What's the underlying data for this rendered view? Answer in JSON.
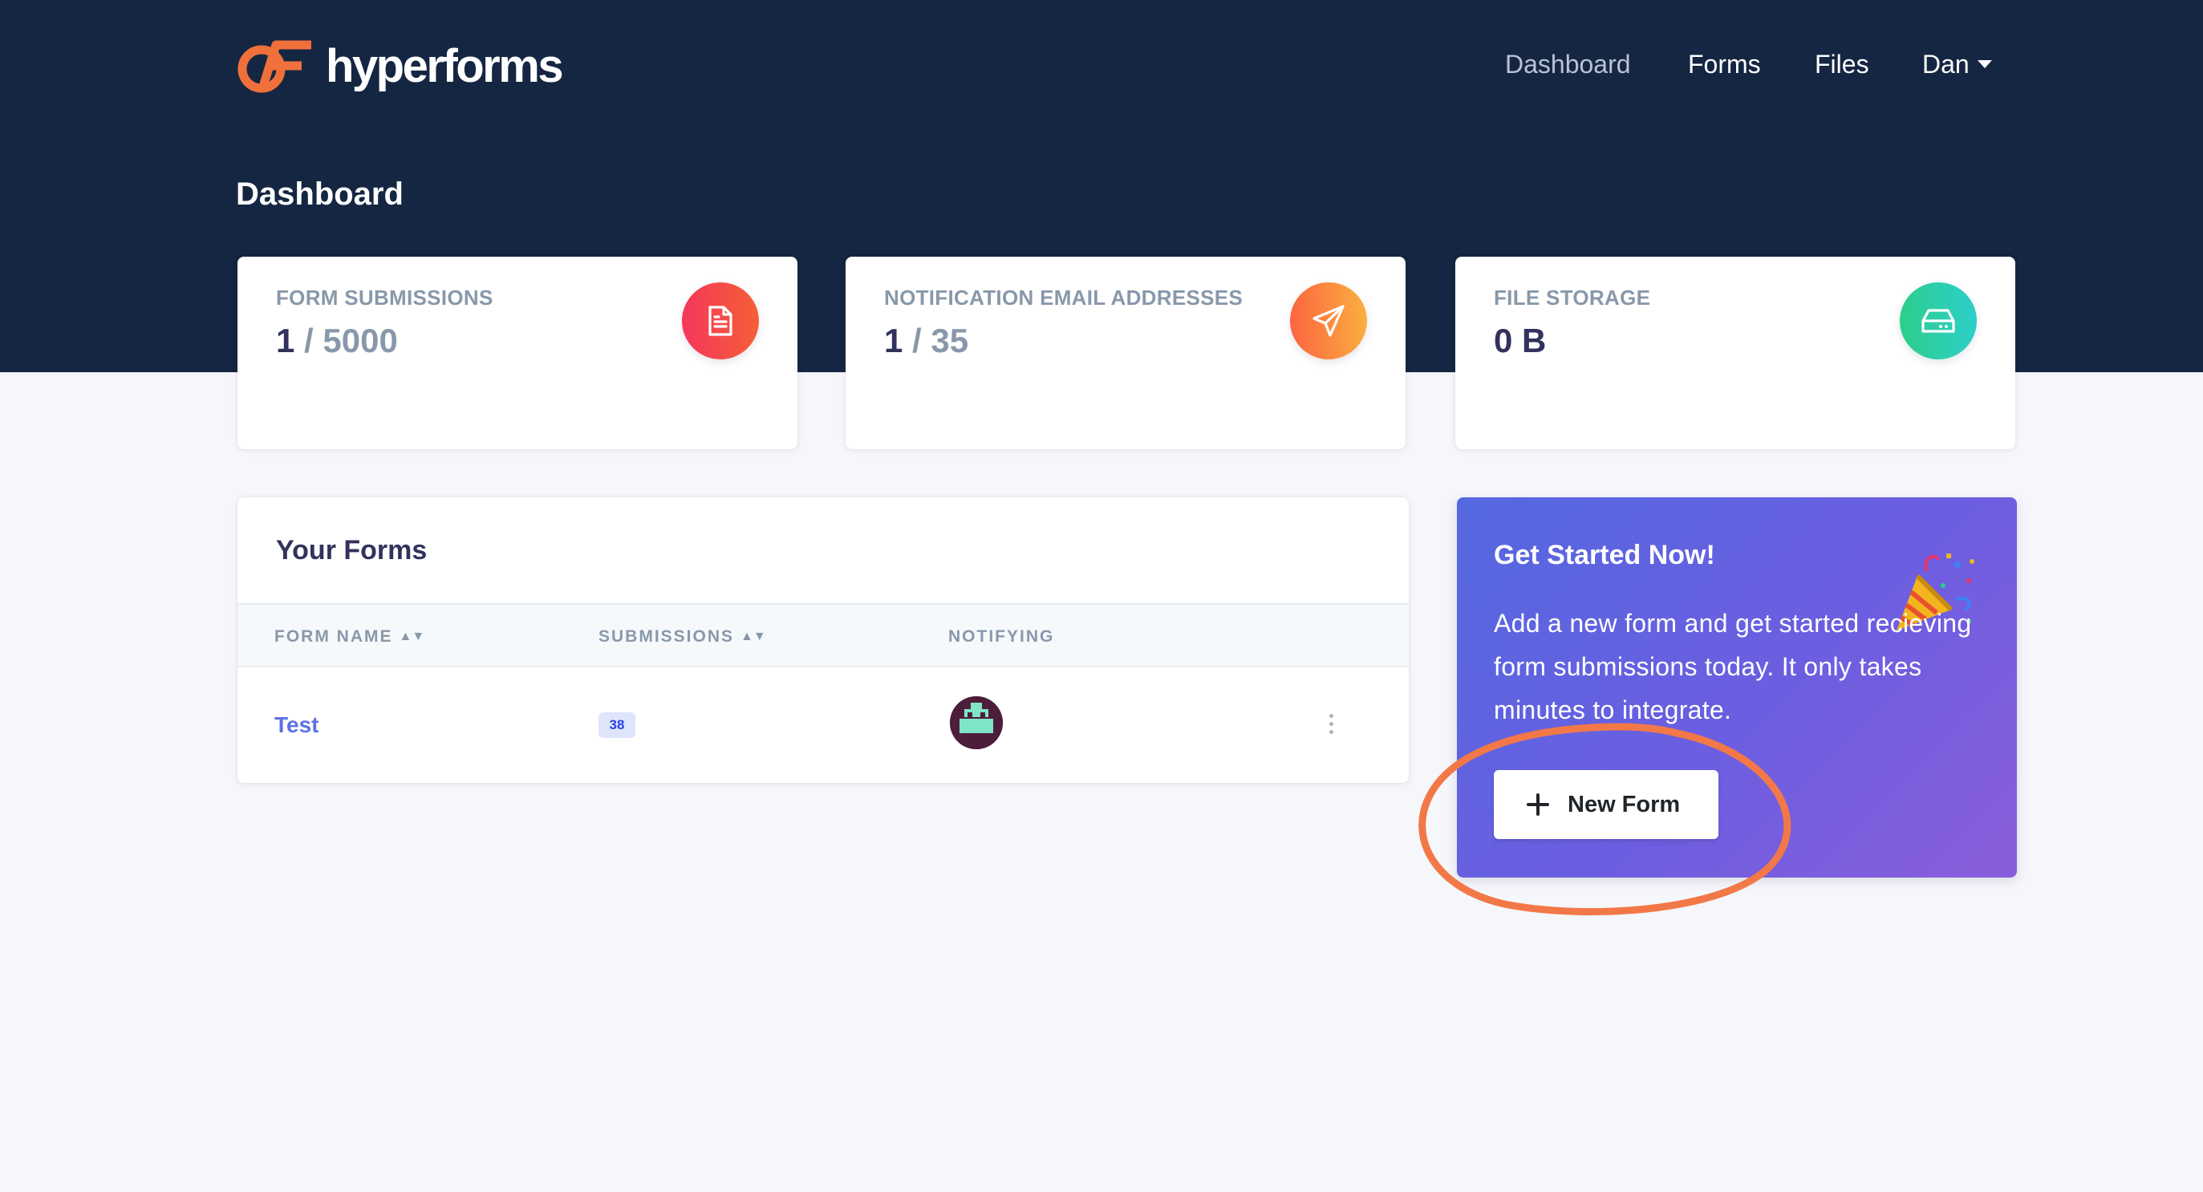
{
  "brand": {
    "name": "hyperforms",
    "accent": "#f0703c"
  },
  "nav": {
    "links": [
      {
        "label": "Dashboard",
        "active": true
      },
      {
        "label": "Forms",
        "active": false
      },
      {
        "label": "Files",
        "active": false
      }
    ],
    "user": {
      "label": "Dan",
      "icon": "caret-down-icon"
    }
  },
  "page": {
    "title": "Dashboard"
  },
  "stats": [
    {
      "label": "FORM SUBMISSIONS",
      "current": "1",
      "limit": "/ 5000",
      "icon": "document-icon",
      "color": "#f5365c"
    },
    {
      "label": "NOTIFICATION EMAIL ADDRESSES",
      "current": "1",
      "limit": "/ 35",
      "icon": "paper-plane-icon",
      "color": "#fb6340"
    },
    {
      "label": "FILE STORAGE",
      "current": "0 B",
      "limit": "",
      "icon": "hard-drive-icon",
      "color": "#2dce89"
    }
  ],
  "forms": {
    "title": "Your Forms",
    "columns": [
      "FORM NAME",
      "SUBMISSIONS",
      "NOTIFYING"
    ],
    "rows": [
      {
        "name": "Test",
        "submissions": "38",
        "notifying": "avatar"
      }
    ]
  },
  "get_started": {
    "title": "Get Started Now!",
    "text": "Add a new form and get started recieving form submissions today. It only takes minutes to integrate.",
    "button": "New Form",
    "emoji": "party-popper-icon"
  },
  "colors": {
    "hero": "#152642",
    "page_bg": "#f6f7fb",
    "link": "#5e72e4",
    "annotation": "#f37848"
  }
}
